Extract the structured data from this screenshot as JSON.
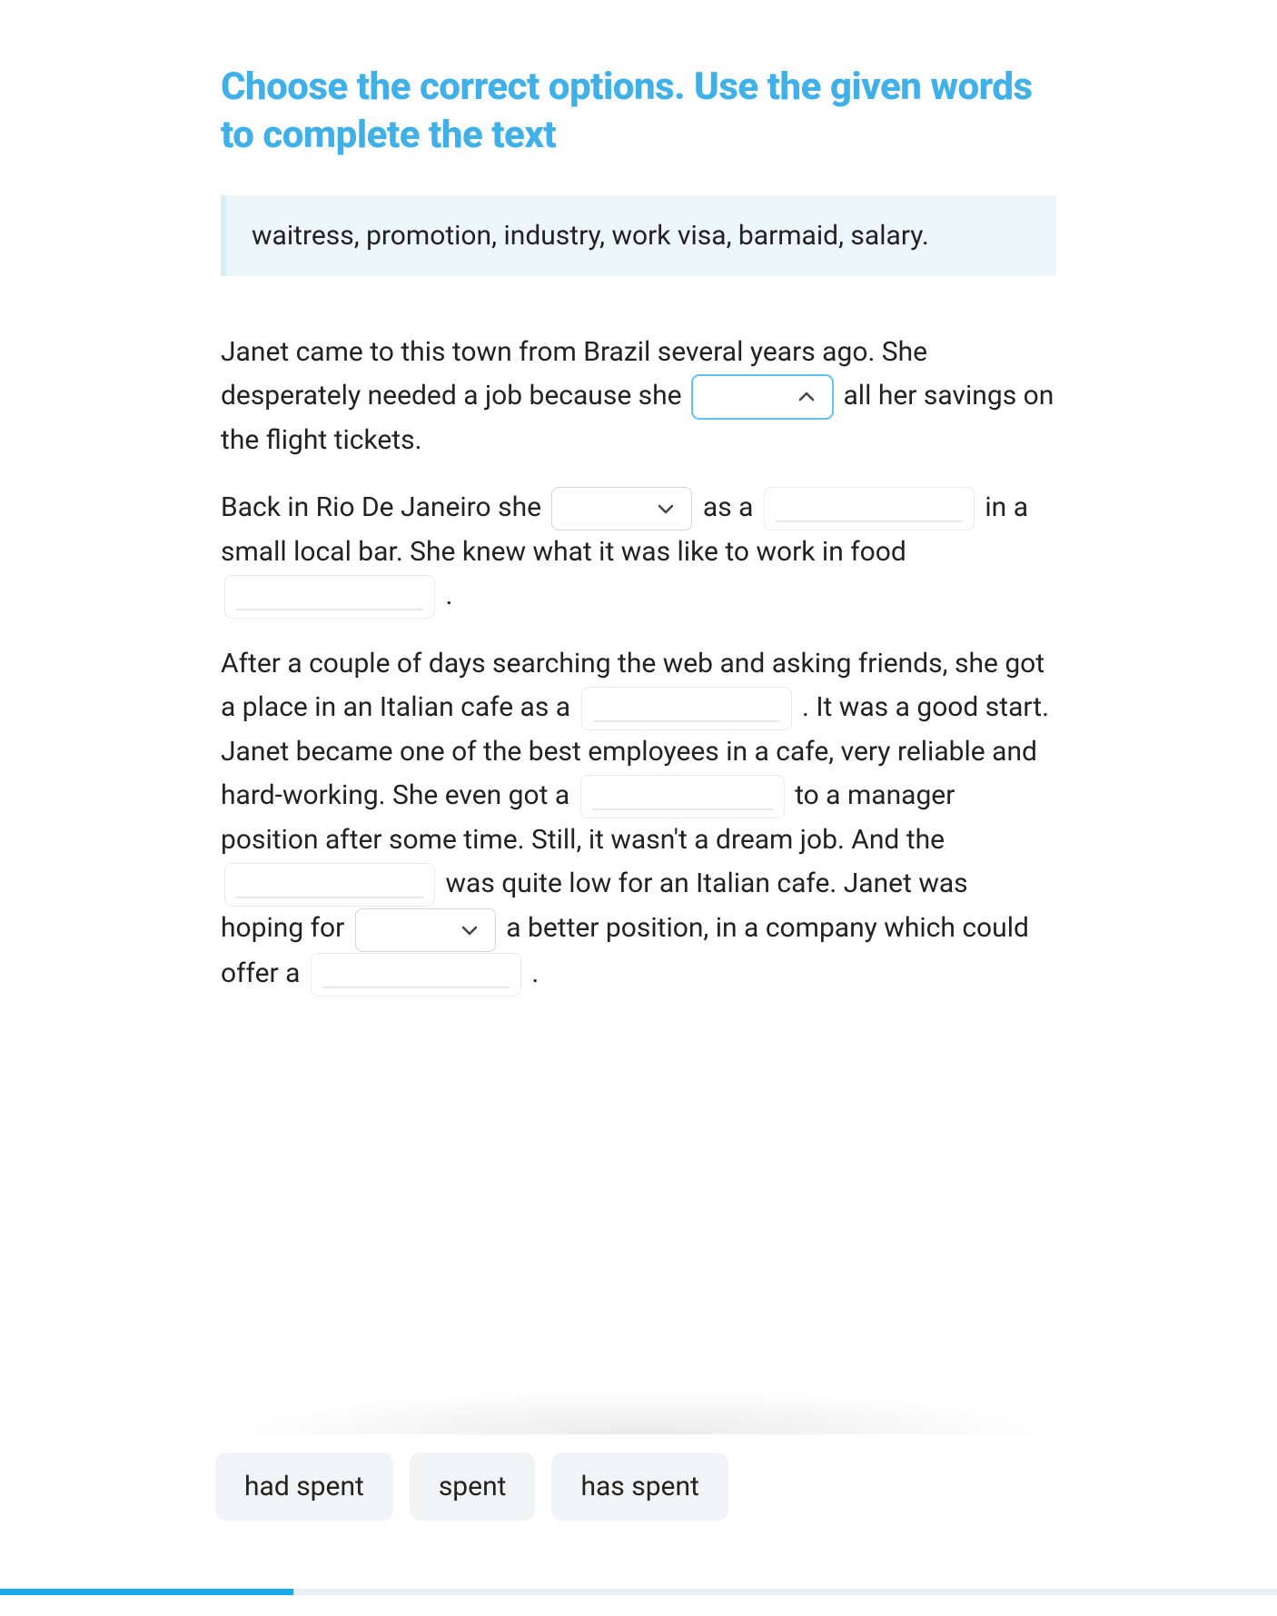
{
  "title": "Choose the correct options. Use the given words to complete the text",
  "wordbank": "waitress, promotion, industry, work visa, barmaid, salary.",
  "text": {
    "p1a": "Janet came to this town from Brazil several years ago. She desperately needed a job because she ",
    "p1b": " all her savings on the flight tickets.",
    "p2a": "Back in Rio De Janeiro she ",
    "p2b": " as a ",
    "p2c": " in a small local bar. She knew what it was like to work in food ",
    "p2d": " .",
    "p3a": "After a couple of days searching the web and asking friends, she got a place in an Italian cafe as a ",
    "p3b": ". It was a good start. Janet became one of the best employees in a cafe, very reliable and hard-working. She even got a ",
    "p3c": " to a manager position after some time. Still, it wasn't a dream job. And the ",
    "p3d": " was quite low for an Italian cafe. Janet was hoping for ",
    "p3e": " a better position, in a company which could offer a ",
    "p3f": "."
  },
  "gaps": {
    "dd1": {
      "type": "dropdown",
      "open": true,
      "value": ""
    },
    "dd2": {
      "type": "dropdown",
      "open": false,
      "value": ""
    },
    "tx1": {
      "type": "text",
      "value": ""
    },
    "tx2": {
      "type": "text",
      "value": ""
    },
    "tx3": {
      "type": "text",
      "value": ""
    },
    "tx4": {
      "type": "text",
      "value": ""
    },
    "tx5": {
      "type": "text",
      "value": ""
    },
    "dd3": {
      "type": "dropdown",
      "open": false,
      "value": ""
    },
    "tx6": {
      "type": "text",
      "value": ""
    }
  },
  "options": [
    "had spent",
    "spent",
    "has spent"
  ],
  "progress_pct": 23
}
